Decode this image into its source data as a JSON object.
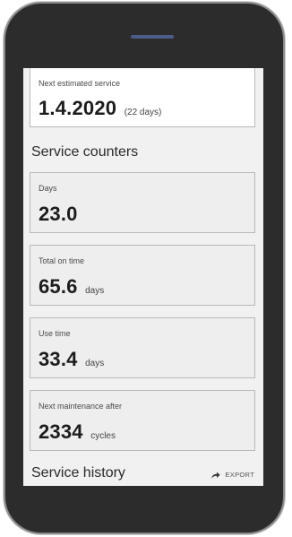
{
  "next_service": {
    "label": "Next estimated service",
    "date": "1.4.2020",
    "remaining": "(22 days)"
  },
  "counters": {
    "title": "Service counters",
    "items": [
      {
        "label": "Days",
        "value": "23.0",
        "unit": ""
      },
      {
        "label": "Total on time",
        "value": "65.6",
        "unit": "days"
      },
      {
        "label": "Use time",
        "value": "33.4",
        "unit": "days"
      },
      {
        "label": "Next maintenance after",
        "value": "2334",
        "unit": "cycles"
      }
    ]
  },
  "history": {
    "title": "Service history",
    "export_label": "EXPORT",
    "export_icon": "share-arrow-icon"
  }
}
